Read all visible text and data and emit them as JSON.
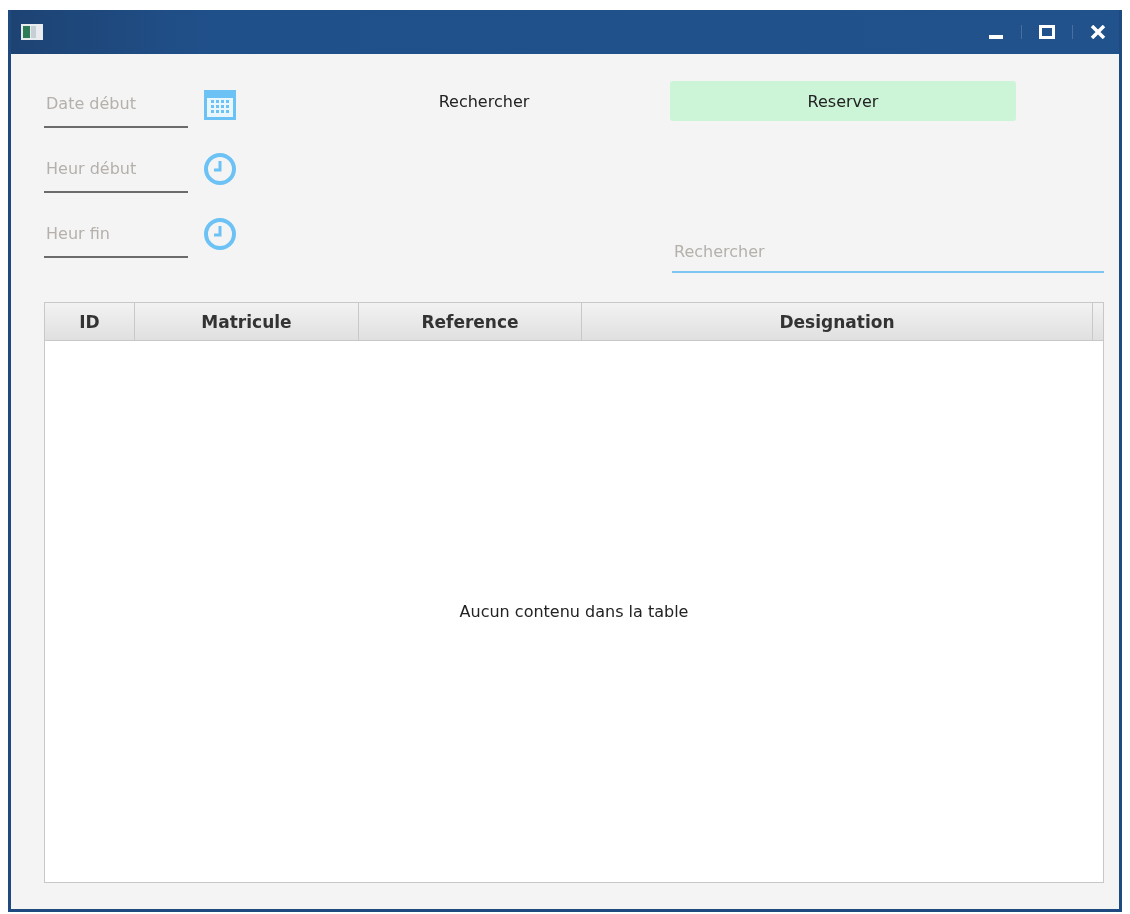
{
  "window": {
    "title_controls": [
      {
        "kind": "minimize"
      },
      {
        "kind": "maximize"
      },
      {
        "kind": "close"
      }
    ]
  },
  "fields": [
    {
      "placeholder": "Date début",
      "kind": "date"
    },
    {
      "placeholder": "Heur début",
      "kind": "time"
    },
    {
      "placeholder": "Heur fin",
      "kind": "time"
    }
  ],
  "search_button": {
    "label": "Rechercher"
  },
  "reserve_button": {
    "label": "Reserver"
  },
  "search": {
    "placeholder": "Rechercher"
  },
  "table": {
    "columns": [
      "ID",
      "Matricule",
      "Reference",
      "Designation"
    ],
    "empty_message": "Aucun contenu dans la table"
  }
}
